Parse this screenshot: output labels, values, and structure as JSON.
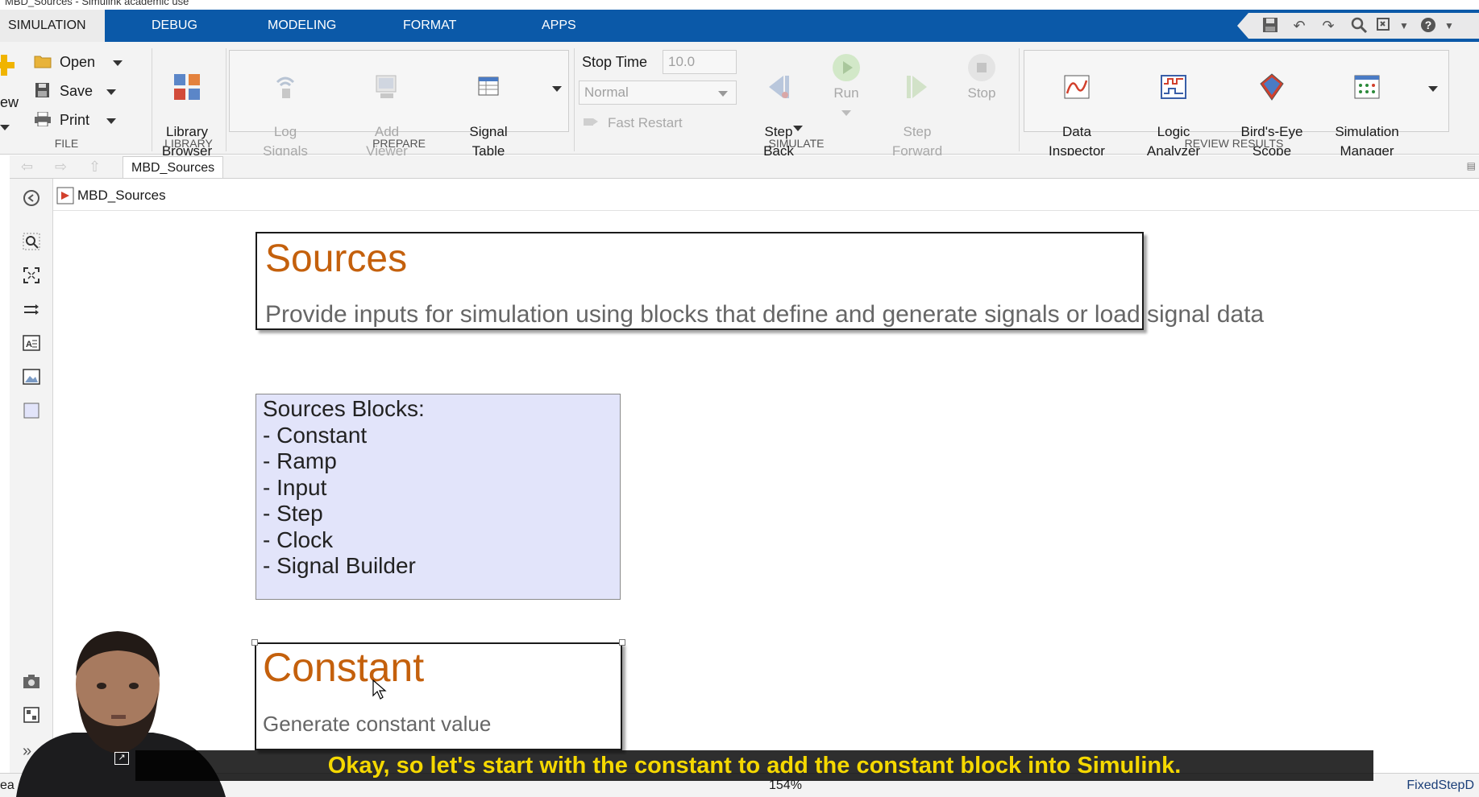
{
  "window": {
    "title": "MBD_Sources - Simulink academic use"
  },
  "tabs": [
    "SIMULATION",
    "DEBUG",
    "MODELING",
    "FORMAT",
    "APPS"
  ],
  "quick_access": [
    "save-icon",
    "undo-icon",
    "redo-icon",
    "search-icon",
    "shortcuts-icon",
    "help-icon"
  ],
  "ribbon": {
    "file": {
      "label": "FILE",
      "new_label": "ew",
      "open_label": "Open",
      "save_label": "Save",
      "print_label": "Print"
    },
    "library": {
      "label": "LIBRARY",
      "library_browser": "Library\nBrowser"
    },
    "prepare": {
      "label": "PREPARE",
      "log_signals": "Log\nSignals",
      "add_viewer": "Add\nViewer",
      "signal_table": "Signal\nTable"
    },
    "simulate": {
      "label": "SIMULATE",
      "stop_time_label": "Stop Time",
      "stop_time_value": "10.0",
      "mode_value": "Normal",
      "fast_restart": "Fast Restart",
      "step_back": "Step\nBack",
      "run": "Run",
      "step_forward": "Step\nForward",
      "stop": "Stop"
    },
    "review": {
      "label": "REVIEW RESULTS",
      "data_inspector": "Data\nInspector",
      "logic_analyzer": "Logic\nAnalyzer",
      "birds_eye": "Bird's-Eye\nScope",
      "sim_manager": "Simulation\nManager"
    }
  },
  "explorer": {
    "tab": "MBD_Sources"
  },
  "address": {
    "model": "MBD_Sources"
  },
  "canvas": {
    "sources_title": "Sources",
    "sources_desc": "Provide inputs for simulation using blocks that define and generate signals or load signal data",
    "blocks": [
      "Sources Blocks:",
      "- Constant",
      "- Ramp",
      "- Input",
      "- Step",
      "- Clock",
      "- Signal Builder"
    ],
    "constant_title": "Constant",
    "constant_desc": "Generate constant value"
  },
  "status": {
    "left": "ea",
    "zoom": "154%",
    "solver": "FixedStepD"
  },
  "caption": "Okay, so let's start with the constant to add the constant block into Simulink.",
  "colors": {
    "accent_blue": "#0b59a8",
    "annotation_orange": "#c4600c",
    "blocks_bg": "#e2e4fa",
    "caption_yellow": "#f5d800"
  }
}
